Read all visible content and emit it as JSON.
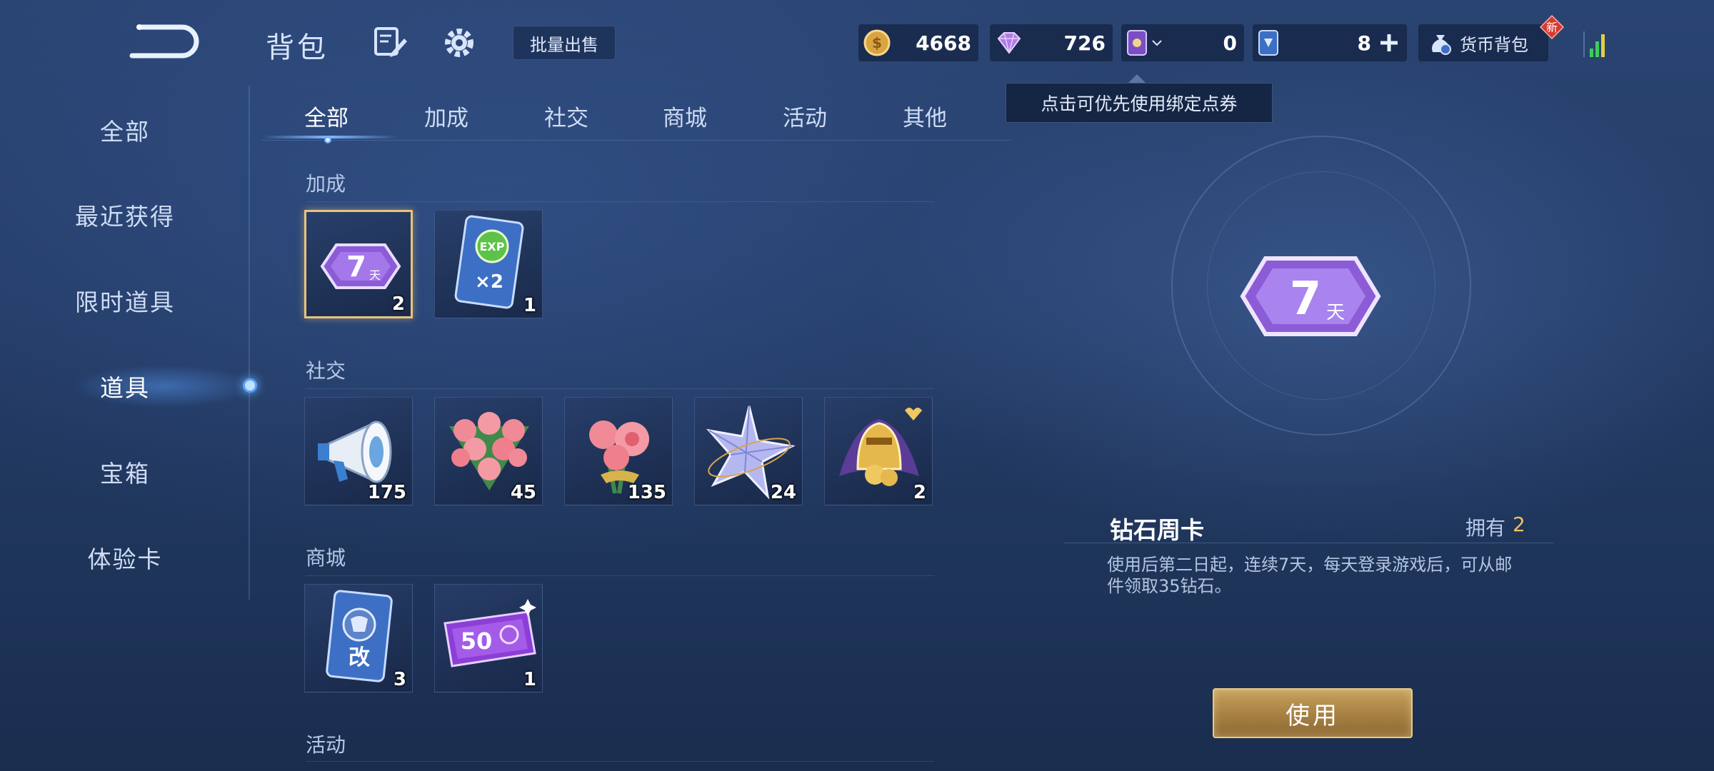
{
  "header": {
    "title": "背包",
    "bulk_sell_label": "批量出售",
    "wallet_label": "货币背包",
    "new_badge": "新"
  },
  "currencies": {
    "coin": "4668",
    "gem": "726",
    "ticket": "0",
    "voucher": "8"
  },
  "tooltip": "点击可优先使用绑定点券",
  "sidebar": {
    "items": [
      {
        "label": "全部"
      },
      {
        "label": "最近获得"
      },
      {
        "label": "限时道具"
      },
      {
        "label": "道具"
      },
      {
        "label": "宝箱"
      },
      {
        "label": "体验卡"
      }
    ],
    "active_index": 3
  },
  "tabs": [
    {
      "label": "全部"
    },
    {
      "label": "加成"
    },
    {
      "label": "社交"
    },
    {
      "label": "商城"
    },
    {
      "label": "活动"
    },
    {
      "label": "其他"
    }
  ],
  "sections": {
    "boost": {
      "title": "加成",
      "items": [
        {
          "icon": "diamond-week-card-icon",
          "qty": "2"
        },
        {
          "icon": "exp-double-card-icon",
          "qty": "1"
        }
      ]
    },
    "social": {
      "title": "社交",
      "items": [
        {
          "icon": "megaphone-icon",
          "qty": "175"
        },
        {
          "icon": "rose-bouquet-large-icon",
          "qty": "45"
        },
        {
          "icon": "rose-bouquet-icon",
          "qty": "135"
        },
        {
          "icon": "crystal-star-icon",
          "qty": "24"
        },
        {
          "icon": "golden-helmet-icon",
          "qty": "2"
        }
      ]
    },
    "shop": {
      "title": "商城",
      "items": [
        {
          "icon": "rename-card-icon",
          "qty": "3"
        },
        {
          "icon": "voucher-50-icon",
          "qty": "1"
        }
      ]
    },
    "event": {
      "title": "活动"
    }
  },
  "detail": {
    "name": "钻石周卡",
    "owned_label": "拥有",
    "owned_value": "2",
    "description": "使用后第二日起，连续7天，每天登录游戏后，可从邮件领取35钻石。",
    "use_label": "使用"
  },
  "colors": {
    "accent_gold": "#e9c37a",
    "owned_value": "#f0c060",
    "purple_card": "#8b5cd6"
  },
  "icon_text": {
    "week_card_digit": "7",
    "week_card_unit": "天",
    "exp": "EXP",
    "exp_multiplier": "×2",
    "rename": "改",
    "voucher_amount": "50"
  }
}
